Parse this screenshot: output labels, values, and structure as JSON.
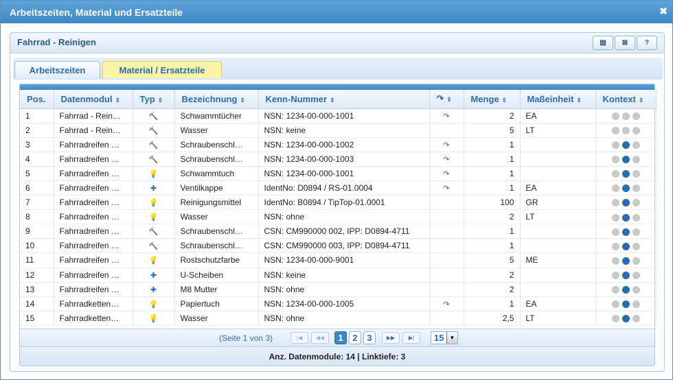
{
  "window": {
    "title": "Arbeitszeiten, Material und Ersatzteile",
    "close_glyph": "✖"
  },
  "panel": {
    "title": "Fahrrad - Reinigen",
    "tools": [
      {
        "icon": "pdf-icon",
        "glyph": "▤"
      },
      {
        "icon": "excel-icon",
        "glyph": "⊠"
      },
      {
        "icon": "help-icon",
        "glyph": "?"
      }
    ]
  },
  "tabs": [
    {
      "label": "Arbeitszeiten",
      "active": false
    },
    {
      "label": "Material / Ersatzteile",
      "active": true
    }
  ],
  "table": {
    "headers": {
      "pos": "Pos.",
      "datenmodul": "Datenmodul",
      "typ": "Typ",
      "bezeichnung": "Bezeichnung",
      "kenn": "Kenn-Nummer",
      "link": "↷",
      "menge": "Menge",
      "masseinheit": "Maßeinheit",
      "kontext": "Kontext"
    },
    "sort_glyph": "⇕",
    "rows": [
      {
        "pos": "1",
        "datenmodul": "Fahrrad - Rein…",
        "typ": "tool-icon",
        "typ_glyph": "🔨",
        "bezeichnung": "Schwammtücher",
        "kenn": "NSN: 1234-00-000-1001",
        "link": "↷",
        "menge": "2",
        "einheit": "EA",
        "ctx": [
          false,
          false,
          false
        ]
      },
      {
        "pos": "2",
        "datenmodul": "Fahrrad - Rein…",
        "typ": "tool-icon",
        "typ_glyph": "🔨",
        "bezeichnung": "Wasser",
        "kenn": "NSN: keine",
        "link": "",
        "menge": "5",
        "einheit": "LT",
        "ctx": [
          false,
          false,
          false
        ]
      },
      {
        "pos": "3",
        "datenmodul": "Fahrradreifen …",
        "typ": "tool-icon",
        "typ_glyph": "🔨",
        "bezeichnung": "Schraubenschl…",
        "kenn": "NSN: 1234-00-000-1002",
        "link": "↷",
        "menge": "1",
        "einheit": "",
        "ctx": [
          false,
          true,
          false
        ]
      },
      {
        "pos": "4",
        "datenmodul": "Fahrradreifen …",
        "typ": "tool-icon",
        "typ_glyph": "🔨",
        "bezeichnung": "Schraubenschl…",
        "kenn": "NSN: 1234-00-000-1003",
        "link": "↷",
        "menge": "1",
        "einheit": "",
        "ctx": [
          false,
          true,
          false
        ]
      },
      {
        "pos": "5",
        "datenmodul": "Fahrradreifen …",
        "typ": "bulb-icon",
        "typ_glyph": "💡",
        "bezeichnung": "Schwammtuch",
        "kenn": "NSN: 1234-00-000-1001",
        "link": "↷",
        "menge": "1",
        "einheit": "",
        "ctx": [
          false,
          true,
          false
        ]
      },
      {
        "pos": "6",
        "datenmodul": "Fahrradreifen …",
        "typ": "puzzle-icon",
        "typ_glyph": "✚",
        "bezeichnung": "Ventilkappe",
        "kenn": "IdentNo: D0894 / RS-01.0004",
        "link": "↷",
        "menge": "1",
        "einheit": "EA",
        "ctx": [
          false,
          true,
          false
        ]
      },
      {
        "pos": "7",
        "datenmodul": "Fahrradreifen …",
        "typ": "bulb-icon",
        "typ_glyph": "💡",
        "bezeichnung": "Reinigungsmittel",
        "kenn": "IdentNo: B0894 / TipTop-01.0001",
        "link": "",
        "menge": "100",
        "einheit": "GR",
        "ctx": [
          false,
          true,
          false
        ]
      },
      {
        "pos": "8",
        "datenmodul": "Fahrradreifen …",
        "typ": "bulb-icon",
        "typ_glyph": "💡",
        "bezeichnung": "Wasser",
        "kenn": "NSN: ohne",
        "link": "",
        "menge": "2",
        "einheit": "LT",
        "ctx": [
          false,
          true,
          false
        ]
      },
      {
        "pos": "9",
        "datenmodul": "Fahrradreifen …",
        "typ": "tool-icon",
        "typ_glyph": "🔨",
        "bezeichnung": "Schraubenschl…",
        "kenn": "CSN: CM990000 002, IPP: D0894-4711",
        "link": "",
        "menge": "1",
        "einheit": "",
        "ctx": [
          false,
          true,
          false
        ]
      },
      {
        "pos": "10",
        "datenmodul": "Fahrradreifen …",
        "typ": "tool-icon",
        "typ_glyph": "🔨",
        "bezeichnung": "Schraubenschl…",
        "kenn": "CSN: CM990000 003, IPP: D0894-4711",
        "link": "",
        "menge": "1",
        "einheit": "",
        "ctx": [
          false,
          true,
          false
        ]
      },
      {
        "pos": "11",
        "datenmodul": "Fahrradreifen …",
        "typ": "bulb-icon",
        "typ_glyph": "💡",
        "bezeichnung": "Rostschutzfarbe",
        "kenn": "NSN: 1234-00-000-9001",
        "link": "",
        "menge": "5",
        "einheit": "ME",
        "ctx": [
          false,
          true,
          false
        ]
      },
      {
        "pos": "12",
        "datenmodul": "Fahrradreifen …",
        "typ": "puzzle-icon",
        "typ_glyph": "✚",
        "bezeichnung": "U-Scheiben",
        "kenn": "NSN: keine",
        "link": "",
        "menge": "2",
        "einheit": "",
        "ctx": [
          false,
          true,
          false
        ]
      },
      {
        "pos": "13",
        "datenmodul": "Fahrradreifen …",
        "typ": "puzzle-icon",
        "typ_glyph": "✚",
        "bezeichnung": "M8 Mutter",
        "kenn": "NSN: ohne",
        "link": "",
        "menge": "2",
        "einheit": "",
        "ctx": [
          false,
          true,
          false
        ]
      },
      {
        "pos": "14",
        "datenmodul": "Fahrradketten…",
        "typ": "bulb-icon",
        "typ_glyph": "💡",
        "bezeichnung": "Papiertuch",
        "kenn": "NSN: 1234-00-000-1005",
        "link": "↷",
        "menge": "1",
        "einheit": "EA",
        "ctx": [
          false,
          true,
          false
        ]
      },
      {
        "pos": "15",
        "datenmodul": "Fahrradketten…",
        "typ": "bulb-icon",
        "typ_glyph": "💡",
        "bezeichnung": "Wasser",
        "kenn": "NSN: ohne",
        "link": "",
        "menge": "2,5",
        "einheit": "LT",
        "ctx": [
          false,
          true,
          false
        ]
      }
    ]
  },
  "pager": {
    "info": "(Seite 1 von 3)",
    "first": "|◀",
    "prev": "◀◀",
    "next": "▶▶",
    "last": "▶|",
    "pages": [
      "1",
      "2",
      "3"
    ],
    "current_page": "1",
    "page_size": "15",
    "dropdown_glyph": "▼"
  },
  "footer": {
    "text": "Anz. Datenmodule: 14 | Linktiefe: 3"
  },
  "colors": {
    "accent": "#3f86c4",
    "tab_active": "#fbf5a8",
    "header_text": "#2a6cb0"
  }
}
